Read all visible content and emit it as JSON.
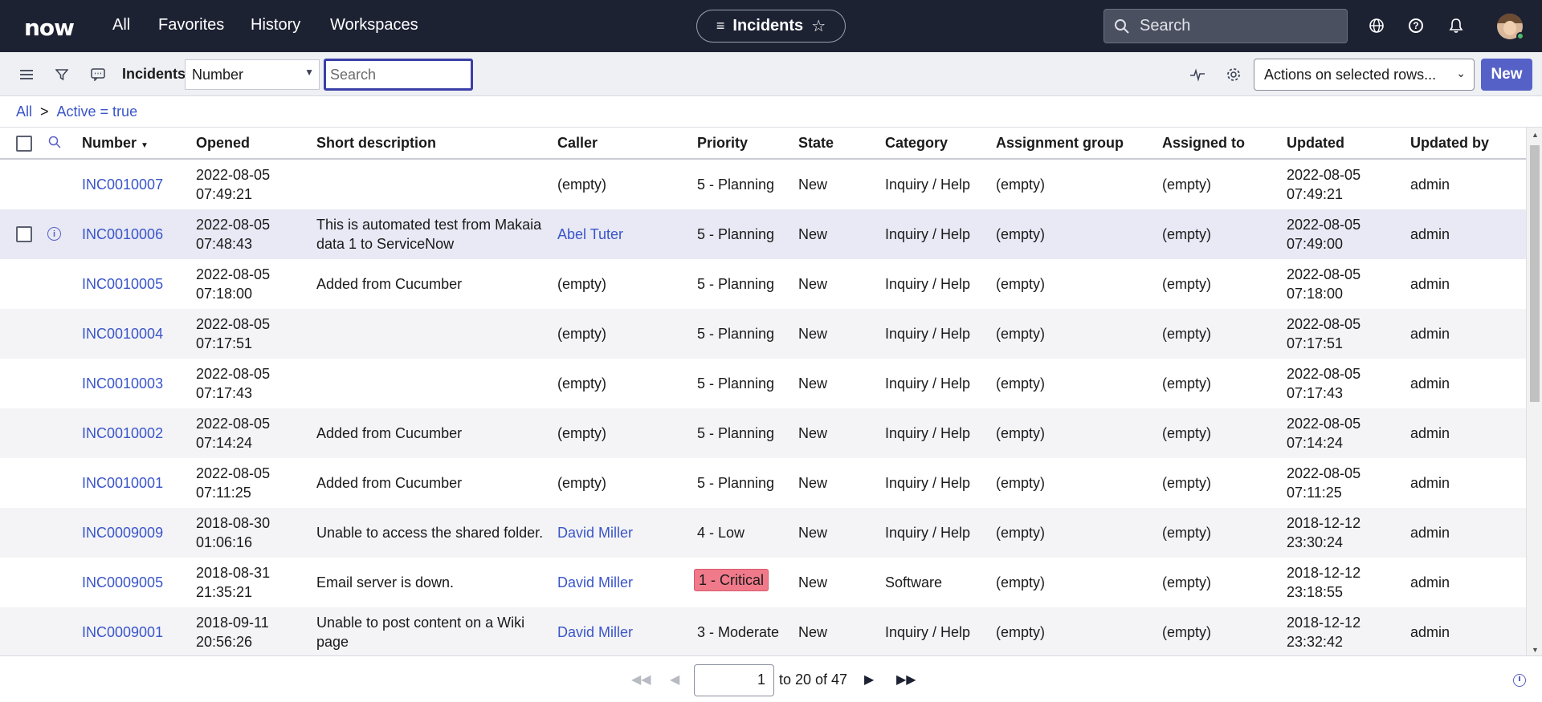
{
  "topnav": {
    "logo": "now",
    "links": [
      "All",
      "Favorites",
      "History",
      "Workspaces"
    ],
    "context_pill": "Incidents",
    "search_placeholder": "Search"
  },
  "toolbar": {
    "title": "Incidents",
    "field_select": "Number",
    "search_placeholder": "Search",
    "actions_select": "Actions on selected rows...",
    "new_label": "New"
  },
  "breadcrumb": {
    "root": "All",
    "separator": ">",
    "filter": "Active = true"
  },
  "table": {
    "columns": [
      "Number",
      "Opened",
      "Short description",
      "Caller",
      "Priority",
      "State",
      "Category",
      "Assignment group",
      "Assigned to",
      "Updated",
      "Updated by"
    ],
    "rows": [
      {
        "number": "INC0010007",
        "opened_date": "2022-08-05",
        "opened_time": "07:49:21",
        "desc1": "",
        "desc2": "",
        "caller": "(empty)",
        "priority": "5 - Planning",
        "state": "New",
        "category": "Inquiry / Help",
        "group": "(empty)",
        "assigned": "(empty)",
        "updated_date": "2022-08-05",
        "updated_time": "07:49:21",
        "updated_by": "admin"
      },
      {
        "number": "INC0010006",
        "opened_date": "2022-08-05",
        "opened_time": "07:48:43",
        "desc1": "This is automated test from Makaia",
        "desc2": "data 1 to ServiceNow",
        "caller": "Abel Tuter",
        "priority": "5 - Planning",
        "state": "New",
        "category": "Inquiry / Help",
        "group": "(empty)",
        "assigned": "(empty)",
        "updated_date": "2022-08-05",
        "updated_time": "07:49:00",
        "updated_by": "admin"
      },
      {
        "number": "INC0010005",
        "opened_date": "2022-08-05",
        "opened_time": "07:18:00",
        "desc1": "Added from Cucumber",
        "desc2": "",
        "caller": "(empty)",
        "priority": "5 - Planning",
        "state": "New",
        "category": "Inquiry / Help",
        "group": "(empty)",
        "assigned": "(empty)",
        "updated_date": "2022-08-05",
        "updated_time": "07:18:00",
        "updated_by": "admin"
      },
      {
        "number": "INC0010004",
        "opened_date": "2022-08-05",
        "opened_time": "07:17:51",
        "desc1": "",
        "desc2": "",
        "caller": "(empty)",
        "priority": "5 - Planning",
        "state": "New",
        "category": "Inquiry / Help",
        "group": "(empty)",
        "assigned": "(empty)",
        "updated_date": "2022-08-05",
        "updated_time": "07:17:51",
        "updated_by": "admin"
      },
      {
        "number": "INC0010003",
        "opened_date": "2022-08-05",
        "opened_time": "07:17:43",
        "desc1": "",
        "desc2": "",
        "caller": "(empty)",
        "priority": "5 - Planning",
        "state": "New",
        "category": "Inquiry / Help",
        "group": "(empty)",
        "assigned": "(empty)",
        "updated_date": "2022-08-05",
        "updated_time": "07:17:43",
        "updated_by": "admin"
      },
      {
        "number": "INC0010002",
        "opened_date": "2022-08-05",
        "opened_time": "07:14:24",
        "desc1": "Added from Cucumber",
        "desc2": "",
        "caller": "(empty)",
        "priority": "5 - Planning",
        "state": "New",
        "category": "Inquiry / Help",
        "group": "(empty)",
        "assigned": "(empty)",
        "updated_date": "2022-08-05",
        "updated_time": "07:14:24",
        "updated_by": "admin"
      },
      {
        "number": "INC0010001",
        "opened_date": "2022-08-05",
        "opened_time": "07:11:25",
        "desc1": "Added from Cucumber",
        "desc2": "",
        "caller": "(empty)",
        "priority": "5 - Planning",
        "state": "New",
        "category": "Inquiry / Help",
        "group": "(empty)",
        "assigned": "(empty)",
        "updated_date": "2022-08-05",
        "updated_time": "07:11:25",
        "updated_by": "admin"
      },
      {
        "number": "INC0009009",
        "opened_date": "2018-08-30",
        "opened_time": "01:06:16",
        "desc1": "Unable to access the shared folder.",
        "desc2": "",
        "caller": "David Miller",
        "priority": "4 - Low",
        "state": "New",
        "category": "Inquiry / Help",
        "group": "(empty)",
        "assigned": "(empty)",
        "updated_date": "2018-12-12",
        "updated_time": "23:30:24",
        "updated_by": "admin"
      },
      {
        "number": "INC0009005",
        "opened_date": "2018-08-31",
        "opened_time": "21:35:21",
        "desc1": "Email server is down.",
        "desc2": "",
        "caller": "David Miller",
        "priority": "1 - Critical",
        "state": "New",
        "category": "Software",
        "group": "(empty)",
        "assigned": "(empty)",
        "updated_date": "2018-12-12",
        "updated_time": "23:18:55",
        "updated_by": "admin"
      },
      {
        "number": "INC0009001",
        "opened_date": "2018-09-11",
        "opened_time": "20:56:26",
        "desc1": "Unable to post content on a Wiki",
        "desc2": "page",
        "caller": "David Miller",
        "priority": "3 - Moderate",
        "state": "New",
        "category": "Inquiry / Help",
        "group": "(empty)",
        "assigned": "(empty)",
        "updated_date": "2018-12-12",
        "updated_time": "23:32:42",
        "updated_by": "admin"
      }
    ]
  },
  "pagination": {
    "current": "1",
    "text": "to 20 of 47"
  },
  "colors": {
    "nav_bg": "#1d2233",
    "accent": "#5661c8",
    "link": "#3a55c9",
    "critical": "#f07a8a"
  }
}
